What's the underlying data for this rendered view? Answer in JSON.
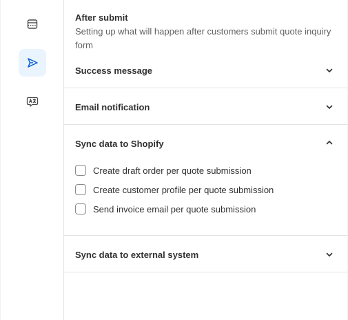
{
  "rail": {
    "items": [
      {
        "icon": "form-icon",
        "active": false
      },
      {
        "icon": "send-icon",
        "active": true
      },
      {
        "icon": "translate-icon",
        "active": false
      }
    ]
  },
  "header": {
    "title": "After submit",
    "description": "Setting up what will happen after customers submit quote inquiry form"
  },
  "sections": [
    {
      "title": "Success message",
      "expanded": false
    },
    {
      "title": "Email notification",
      "expanded": false
    },
    {
      "title": "Sync data to Shopify",
      "expanded": true,
      "options": [
        {
          "label": "Create draft order per quote submission",
          "checked": false
        },
        {
          "label": "Create customer profile per quote submission",
          "checked": false
        },
        {
          "label": "Send invoice email per quote submission",
          "checked": false
        }
      ]
    },
    {
      "title": "Sync data to external system",
      "expanded": false
    }
  ],
  "colors": {
    "active_rail_bg": "#eaf4ff",
    "active_icon": "#005bd3",
    "border": "#e3e3e3"
  }
}
